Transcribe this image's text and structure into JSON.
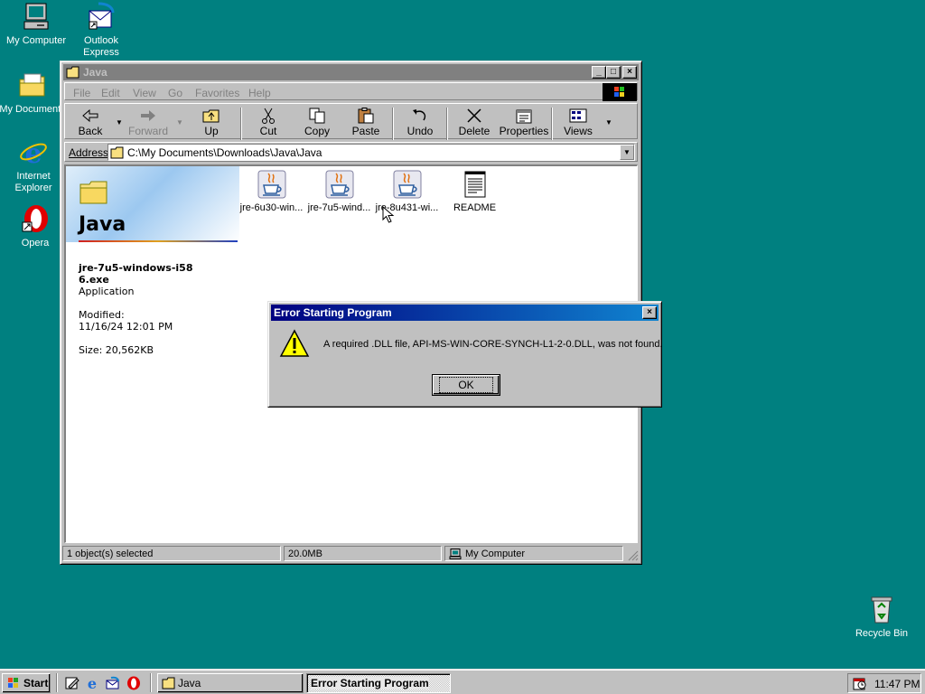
{
  "desktop": {
    "icons": [
      {
        "label": "My Computer"
      },
      {
        "label": "Outlook Express"
      },
      {
        "label": "My Documents"
      },
      {
        "label": "Internet Explorer"
      },
      {
        "label": "Opera"
      },
      {
        "label": "Recycle Bin"
      }
    ]
  },
  "explorer": {
    "title": "Java",
    "menu": [
      "File",
      "Edit",
      "View",
      "Go",
      "Favorites",
      "Help"
    ],
    "toolbar": {
      "back": "Back",
      "forward": "Forward",
      "up": "Up",
      "cut": "Cut",
      "copy": "Copy",
      "paste": "Paste",
      "undo": "Undo",
      "delete": "Delete",
      "properties": "Properties",
      "views": "Views"
    },
    "address_label": "Address",
    "address_value": "C:\\My Documents\\Downloads\\Java\\Java",
    "files": [
      {
        "name": "jre-6u30-win..."
      },
      {
        "name": "jre-7u5-wind..."
      },
      {
        "name": "jre-8u431-wi..."
      },
      {
        "name": "README"
      }
    ],
    "info_panel": {
      "folder_name": "Java",
      "file_name": "jre-7u5-windows-i586.exe",
      "file_type": "Application",
      "modified_label": "Modified:",
      "modified_value": "11/16/24 12:01 PM",
      "size": "Size: 20,562KB"
    },
    "status": {
      "selected": "1 object(s) selected",
      "size": "20.0MB",
      "zone": "My Computer"
    }
  },
  "dialog": {
    "title": "Error Starting Program",
    "message": "A required .DLL file, API-MS-WIN-CORE-SYNCH-L1-2-0.DLL, was not found.",
    "ok": "OK"
  },
  "taskbar": {
    "start": "Start",
    "tasks": [
      {
        "label": "Java"
      },
      {
        "label": "Error Starting Program"
      }
    ],
    "clock": "11:47 PM"
  },
  "colors": {
    "desktop": "#008080",
    "title_active": "#000080",
    "title_inactive": "#808080",
    "chrome": "#c0c0c0"
  }
}
